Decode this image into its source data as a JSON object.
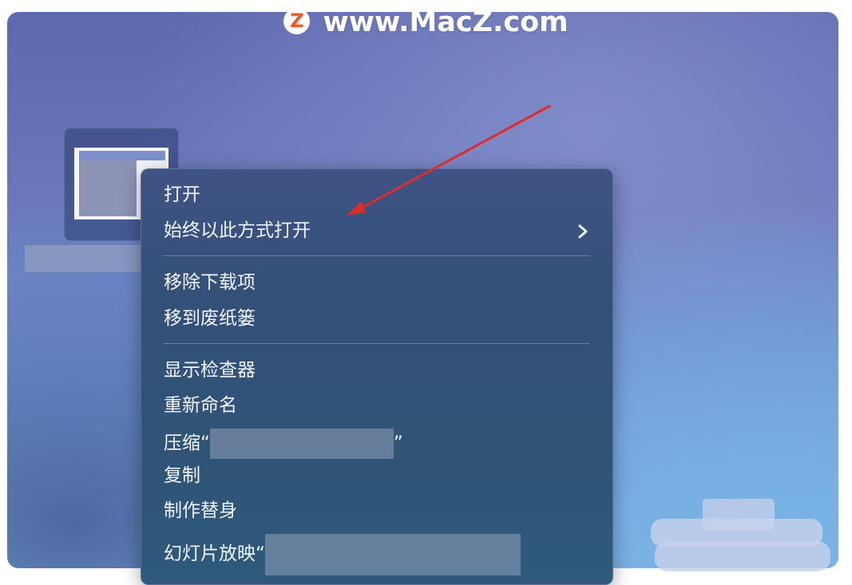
{
  "watermark": {
    "logo_letter": "Z",
    "text": "www.MacZ.com"
  },
  "context_menu": {
    "items": [
      {
        "label": "打开"
      },
      {
        "label": "始终以此方式打开",
        "submenu": true
      },
      {
        "label": "移除下载项"
      },
      {
        "label": "移到废纸篓"
      },
      {
        "label": "显示检查器"
      },
      {
        "label": "重新命名"
      },
      {
        "label": "压缩“",
        "suffix": "”"
      },
      {
        "label": "复制"
      },
      {
        "label": "制作替身"
      },
      {
        "label": "幻灯片放映“"
      }
    ]
  },
  "colors": {
    "annotation_arrow": "#e02b2b",
    "menu_text": "#f2f5fa"
  },
  "icons": [
    "chevron-right-icon",
    "file-icon",
    "annotation-arrow"
  ]
}
